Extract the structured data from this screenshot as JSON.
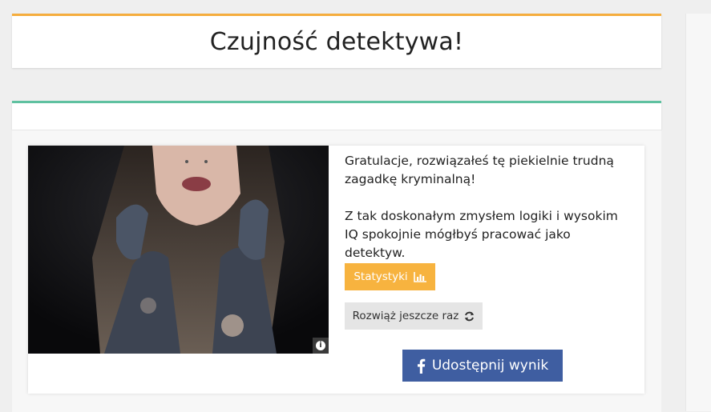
{
  "page": {
    "title": "Czujność detektywa!"
  },
  "result": {
    "message_line1": "Gratulacje, rozwiązałeś tę piekielnie trudną zagadkę kryminalną!",
    "message_line2": "Z tak doskonałym zmysłem logiki i wysokim IQ spokojnie mógłbyś pracować jako detektyw.",
    "image_icon": "info-icon"
  },
  "buttons": {
    "stats_label": "Statystyki",
    "stats_icon": "bar-chart-icon",
    "retry_label": "Rozwiąż jeszcze raz",
    "retry_icon": "refresh-icon",
    "share_label": "Udostępnij wynik",
    "share_icon": "facebook-icon"
  },
  "colors": {
    "title_accent": "#f5ad3d",
    "section_accent": "#5fc1a0",
    "stats_button": "#f7b33f",
    "share_button": "#3f5ea1"
  }
}
